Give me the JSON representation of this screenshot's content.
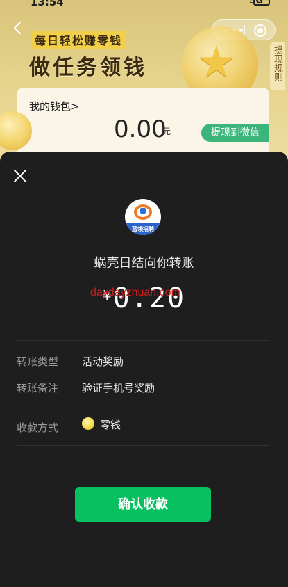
{
  "status_bar": {
    "time": "13:54",
    "signal": "5G"
  },
  "background_page": {
    "hero_subtitle": "每日轻松赚零钱",
    "hero_title": "做任务领钱",
    "rules_tab": "提现规则",
    "wallet": {
      "label": "我的钱包>",
      "amount": "0.00",
      "unit": "元",
      "withdraw_button": "提现到微信"
    }
  },
  "sheet": {
    "logo_text": "蓝领招聘",
    "payer_line": "蜗壳日结向你转账",
    "currency_symbol": "¥",
    "amount": "0.20",
    "watermark": "daydayzhuan.com",
    "rows": [
      {
        "label": "转账类型",
        "value": "活动奖励"
      },
      {
        "label": "转账备注",
        "value": "验证手机号奖励"
      }
    ],
    "receive_method": {
      "label": "收款方式",
      "value": "零钱"
    },
    "confirm_button": "确认收款"
  },
  "colors": {
    "sheet_bg": "#1e1e1e",
    "confirm_green": "#07c160",
    "watermark_red": "#d21d1d",
    "withdraw_green": "#3cb57a"
  },
  "icons": [
    "back-arrow-icon",
    "more-dots-icon",
    "mini-program-close-icon",
    "close-icon",
    "app-logo-icon",
    "change-coin-icon",
    "star-coin-icon"
  ]
}
